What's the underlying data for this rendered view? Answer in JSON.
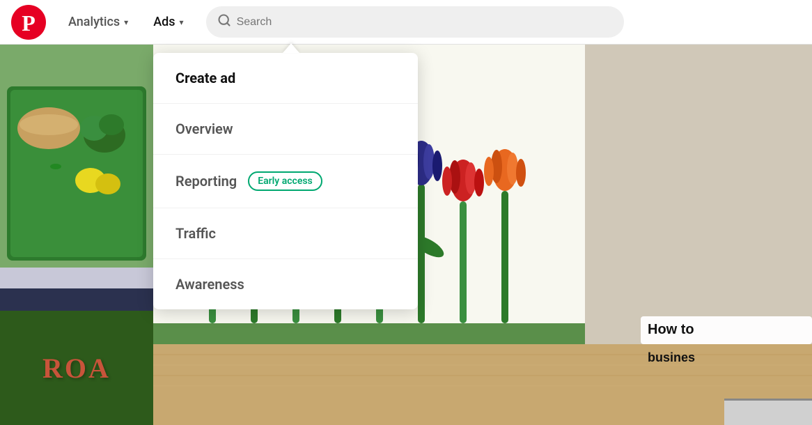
{
  "header": {
    "logo_letter": "p",
    "nav_links": [
      {
        "label": "Analytics",
        "has_chevron": true,
        "active": false
      },
      {
        "label": "Ads",
        "has_chevron": true,
        "active": true
      }
    ],
    "search": {
      "placeholder": "Search"
    }
  },
  "dropdown": {
    "items": [
      {
        "label": "Create ad",
        "badge": null
      },
      {
        "label": "Overview",
        "badge": null
      },
      {
        "label": "Reporting",
        "badge": "Early access"
      },
      {
        "label": "Traffic",
        "badge": null
      },
      {
        "label": "Awareness",
        "badge": null
      }
    ]
  },
  "content": {
    "roa_text": "ROA",
    "howto_title": "How to",
    "howto_subtitle": "busines"
  },
  "colors": {
    "pinterest_red": "#e60023",
    "early_access_green": "#00a870",
    "nav_text": "#555555",
    "active_text": "#111111"
  }
}
